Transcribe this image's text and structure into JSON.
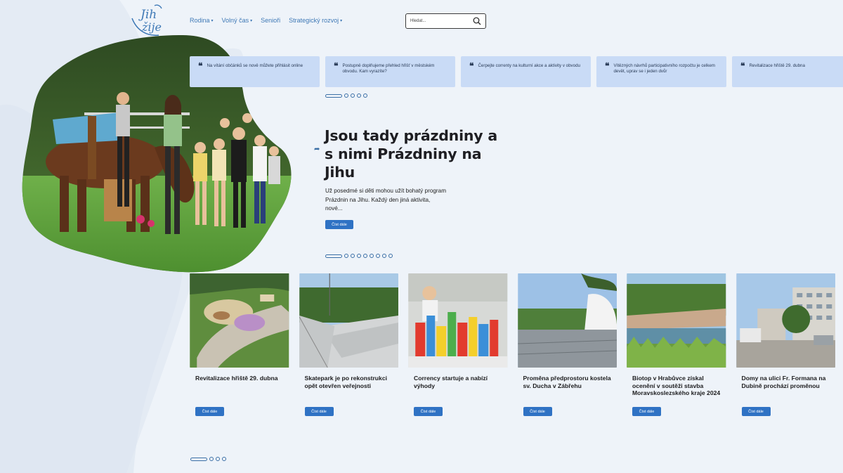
{
  "header": {
    "logo_text": "Jih žije",
    "nav": [
      {
        "label": "Rodina",
        "has_dropdown": true
      },
      {
        "label": "Volný čas",
        "has_dropdown": true
      },
      {
        "label": "Senioři",
        "has_dropdown": false
      },
      {
        "label": "Strategický rozvoj",
        "has_dropdown": true
      }
    ],
    "search": {
      "placeholder": "Hledat...",
      "icon": "search-icon"
    }
  },
  "quotes": [
    {
      "text": "Na vítání občánků se nově můžete přihlásit online"
    },
    {
      "text": "Postupně doplňujeme přehled hřišť v městském obvodu. Kam vyrazíte?"
    },
    {
      "text": "Čerpejte correnty na kulturní akce a aktivity v obvodu"
    },
    {
      "text": "Vítězných návrhů participativního rozpočtu je celkem devět, uprav se i jeden dvůr"
    },
    {
      "text": "Revitalizace hřiště 29. dubna"
    }
  ],
  "quote_dots": {
    "count": 5,
    "active": 0
  },
  "hero": {
    "title": "Jsou tady prázdniny a s nimi Prázdniny na Jihu",
    "description": "Už posedmé si děti mohou užít bohatý program Prázdnin na Jihu. Každý den jiná aktivita, nové...",
    "button": "Číst dále"
  },
  "hero_dots": {
    "count": 10,
    "active": 0
  },
  "cards": [
    {
      "title": "Revitalizace hřiště 29. dubna",
      "button": "Číst dále"
    },
    {
      "title": "Skatepark je po rekonstrukci opět otevřen veřejnosti",
      "button": "Číst dále"
    },
    {
      "title": "Corrency startuje a nabízí výhody",
      "button": "Číst dále"
    },
    {
      "title": "Proměna předprostoru kostela sv. Ducha v Zábřehu",
      "button": "Číst dále"
    },
    {
      "title": "Biotop v Hrabůvce získal ocenění v soutěži stavba Moravskoslezského kraje 2024",
      "button": "Číst dále"
    },
    {
      "title": "Domy na ulici Fr. Formana na Dubině prochází proměnou",
      "button": "Číst dále"
    }
  ],
  "card_dots": {
    "count": 4,
    "active": 0
  },
  "colors": {
    "accent": "#2f72c4",
    "nav": "#3f79b6",
    "quote_bg": "#c9dbf6",
    "page_bg": "#eef3f9"
  }
}
